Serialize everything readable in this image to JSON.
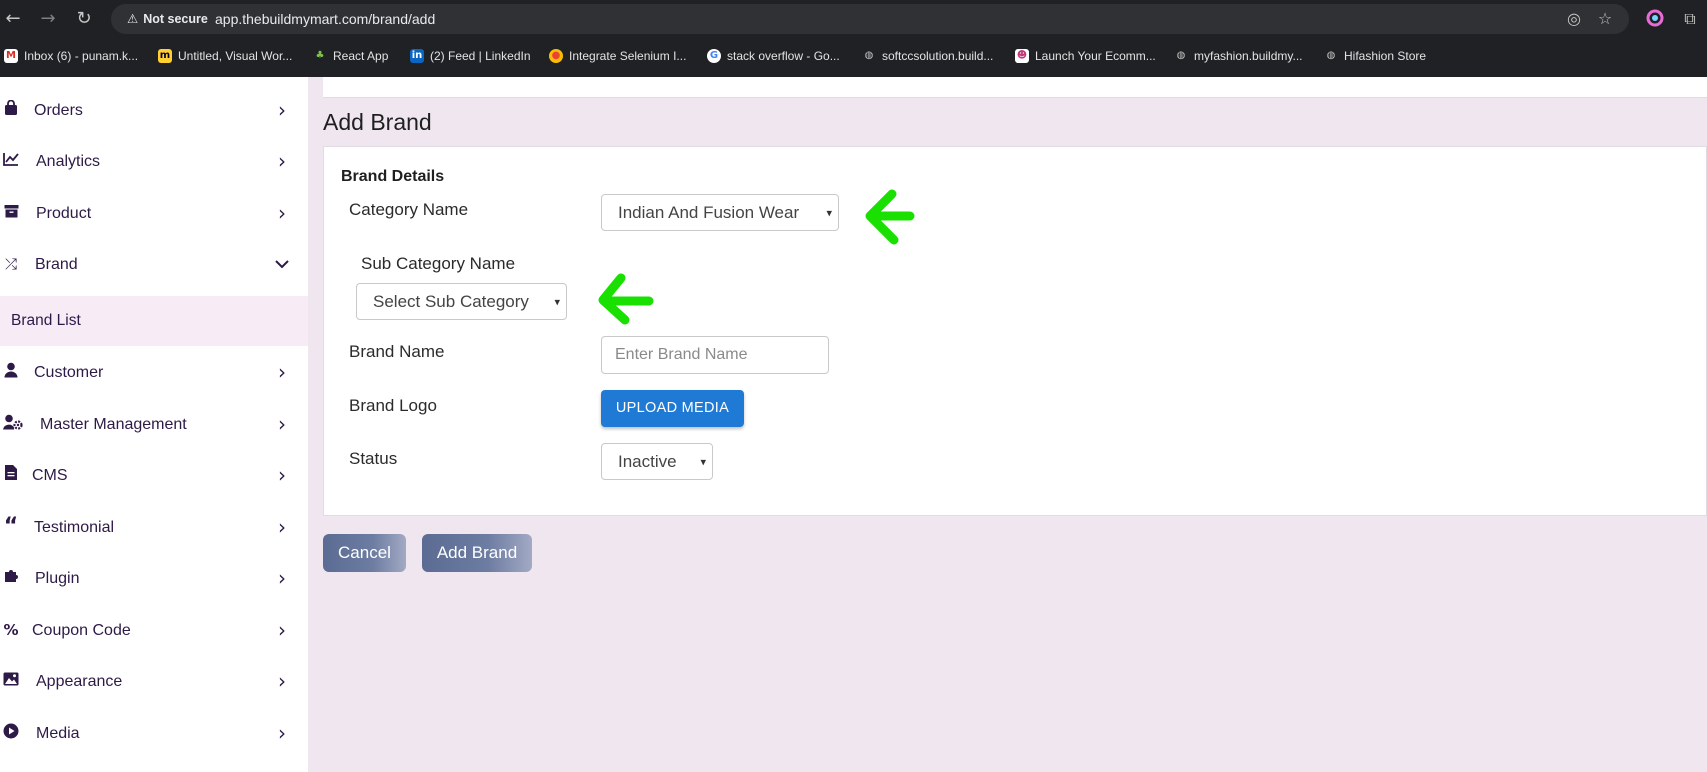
{
  "browser": {
    "security_label": "Not secure",
    "url": "app.thebuildmymart.com/brand/add",
    "bookmarks": [
      {
        "label": "Inbox (6) - punam.k...",
        "icon": "gmail-icon"
      },
      {
        "label": "Untitled, Visual Wor...",
        "icon": "miro-icon"
      },
      {
        "label": "React App",
        "icon": "leaf-icon"
      },
      {
        "label": "(2) Feed | LinkedIn",
        "icon": "linkedin-icon"
      },
      {
        "label": "Integrate Selenium I...",
        "icon": "chrome-icon"
      },
      {
        "label": "stack overflow - Go...",
        "icon": "google-icon"
      },
      {
        "label": "softccsolution.build...",
        "icon": "globe-icon"
      },
      {
        "label": "Launch Your Ecomm...",
        "icon": "store-icon"
      },
      {
        "label": "myfashion.buildmy...",
        "icon": "globe-icon"
      },
      {
        "label": "Hifashion Store",
        "icon": "globe-icon"
      }
    ]
  },
  "sidebar": {
    "items": [
      {
        "label": "Orders",
        "icon": "shopping-bag-icon"
      },
      {
        "label": "Analytics",
        "icon": "line-chart-icon"
      },
      {
        "label": "Product",
        "icon": "archive-box-icon"
      },
      {
        "label": "Brand",
        "icon": "shuffle-icon",
        "expanded": true
      },
      {
        "label": "Customer",
        "icon": "user-icon"
      },
      {
        "label": "Master Management",
        "icon": "user-gear-icon"
      },
      {
        "label": "CMS",
        "icon": "document-icon"
      },
      {
        "label": "Testimonial",
        "icon": "quote-icon"
      },
      {
        "label": "Plugin",
        "icon": "puzzle-icon"
      },
      {
        "label": "Coupon Code",
        "icon": "percent-icon"
      },
      {
        "label": "Appearance",
        "icon": "image-icon"
      },
      {
        "label": "Media",
        "icon": "play-circle-icon"
      }
    ],
    "sub_item": "Brand List"
  },
  "main": {
    "title": "Add Brand",
    "section_title": "Brand Details",
    "category_label": "Category Name",
    "category_value": "Indian And Fusion Wear",
    "subcategory_label": "Sub Category Name",
    "subcategory_value": "Select Sub Category",
    "brand_name_label": "Brand Name",
    "brand_name_placeholder": "Enter Brand Name",
    "brand_logo_label": "Brand Logo",
    "upload_label": "UPLOAD MEDIA",
    "status_label": "Status",
    "status_value": "Inactive",
    "cancel_label": "Cancel",
    "submit_label": "Add Brand"
  },
  "colors": {
    "accent": "#1f7ad6",
    "annotation_arrow": "#19e000",
    "sidebar_text": "#2e1a47",
    "background": "#efe6f0"
  }
}
